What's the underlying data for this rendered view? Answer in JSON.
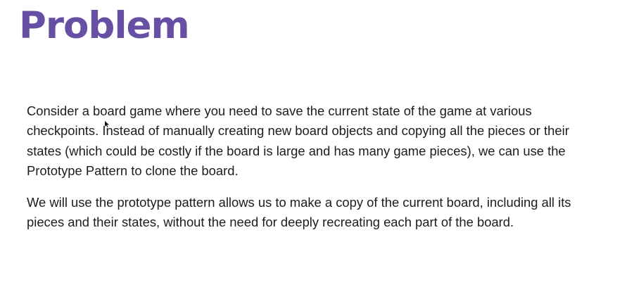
{
  "slide": {
    "title": "Problem",
    "paragraphs": [
      "Consider a board game where you need to save the current state of the game at various checkpoints. Instead of manually creating new board objects and copying all the pieces or their states (which could be costly if the board is large and has many game pieces), we can use the Prototype Pattern to clone the board.",
      "We will use the prototype pattern allows us to make a copy of the current board, including all its pieces and their states, without the need for deeply recreating each part of the board."
    ]
  },
  "colors": {
    "title": "#6750a4",
    "text": "#1c1c1c",
    "background": "#ffffff"
  },
  "icons": {
    "cursor": "mouse-pointer-icon"
  }
}
